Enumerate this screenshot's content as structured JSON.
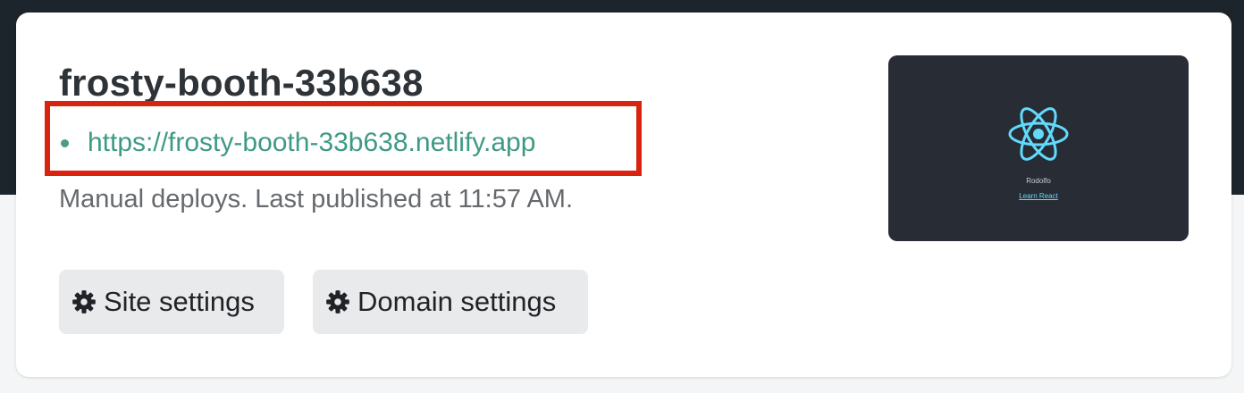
{
  "site": {
    "name": "frosty-booth-33b638",
    "url": "https://frosty-booth-33b638.netlify.app",
    "status": "Manual deploys. Last published at 11:57 AM."
  },
  "actions": {
    "site_settings_label": "Site settings",
    "domain_settings_label": "Domain settings",
    "icon": "gear-icon"
  },
  "preview": {
    "logo_icon": "react-logo-icon",
    "caption": "Rodolfo",
    "link_label": "Learn React"
  },
  "colors": {
    "header_band": "#1d252c",
    "link": "#3e9a84",
    "highlight_border": "#d9230f",
    "preview_bg": "#282c34",
    "react_logo": "#61dafb"
  }
}
